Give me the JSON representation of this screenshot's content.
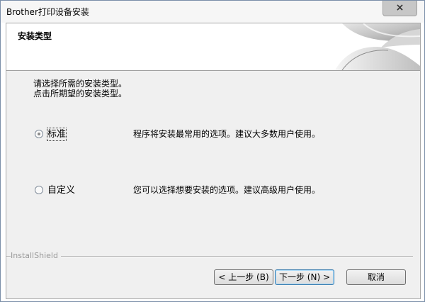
{
  "window": {
    "title": "Brother打印设备安装",
    "close_glyph": "×"
  },
  "banner": {
    "title": "安装类型"
  },
  "instructions": {
    "line1": "请选择所需的安装类型。",
    "line2": "点击所期望的安装类型。"
  },
  "options": [
    {
      "label": "标准",
      "description": "程序将安装最常用的选项。建议大多数用户使用。",
      "selected": true
    },
    {
      "label": "自定义",
      "description": "您可以选择想要安装的选项。建议高级用户使用。",
      "selected": false
    }
  ],
  "footer": {
    "brand": "InstallShield",
    "back_label": "< 上一步 (B)",
    "next_label": "下一步 (N) >",
    "cancel_label": "取消"
  },
  "colors": {
    "dialog_bg": "#f0f0f0",
    "default_button_border": "#3c7fb1"
  }
}
